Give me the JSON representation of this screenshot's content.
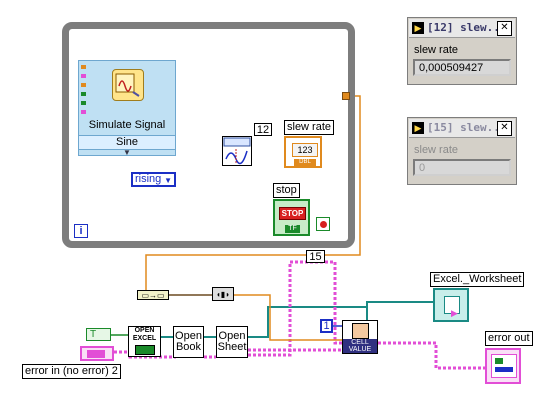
{
  "loop": {
    "iteration_icon": "i",
    "count_out": "15"
  },
  "express_vi": {
    "title": "Simulate Signal",
    "signal_type": "Sine"
  },
  "ring": {
    "value": "rising"
  },
  "iteration_const": "12",
  "slew_indicator": {
    "label": "slew rate",
    "type": "123",
    "subtype": "DBL"
  },
  "stop_control": {
    "label": "stop",
    "text": "STOP",
    "type": "TF"
  },
  "excel": {
    "open_excel": "OPEN\nEXCEL",
    "open_book": "Open\nBook",
    "open_sheet": "Open\nSheet",
    "cell_value": "CELL\nVALUE",
    "row_const": "1",
    "worksheet_label": "Excel._Worksheet",
    "error_in_label": "error in (no error) 2",
    "error_out_label": "error out",
    "bool_const": "T"
  },
  "windows": [
    {
      "title": "[12] slew...",
      "label": "slew rate",
      "value": "0,000509427",
      "active": true
    },
    {
      "title": "[15] slew...",
      "label": "slew rate",
      "value": "0",
      "active": false
    }
  ],
  "colors": {
    "loop_border": "#7d7d7d",
    "orange_wire": "#e08a1e",
    "blue_wire": "#1b2fc5",
    "pink_wire": "#e24ed6",
    "teal_wire": "#1a8a84",
    "dynamic_wire": "#2b2b2b"
  }
}
